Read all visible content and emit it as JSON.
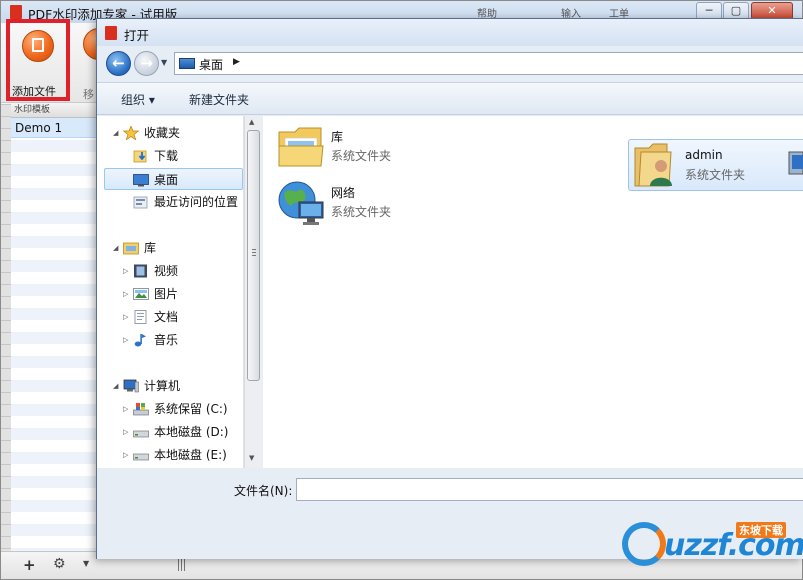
{
  "app": {
    "title": "PDF水印添加专家 - 试用版",
    "menu": [
      "帮助",
      "输入",
      "工单"
    ],
    "window_controls": {
      "minimize": "─",
      "maximize": "▢",
      "close": "✕"
    },
    "toolbar": {
      "add_file_label": "添加文件",
      "move_label": "移"
    },
    "template_panel": {
      "header": "水印模板",
      "items": [
        "Demo 1"
      ]
    },
    "statusbar": {
      "add": "+",
      "settings": "⚙",
      "dropdown": "▼"
    }
  },
  "dialog": {
    "title": "打开",
    "address": {
      "location": "桌面",
      "chevron": "▶"
    },
    "nav_buttons": {
      "back": "←",
      "forward": "→",
      "history": "▼"
    },
    "commands": {
      "organize": "组织 ▾",
      "new_folder": "新建文件夹"
    },
    "nav_tree": {
      "favorites": {
        "label": "收藏夹",
        "items": [
          "下载",
          "桌面",
          "最近访问的位置"
        ]
      },
      "libraries": {
        "label": "库",
        "items": [
          "视频",
          "图片",
          "文档",
          "音乐"
        ]
      },
      "computer": {
        "label": "计算机",
        "items": [
          "系统保留 (C:)",
          "本地磁盘 (D:)",
          "本地磁盘 (E:)"
        ]
      }
    },
    "content_items": [
      {
        "name": "库",
        "type": "系统文件夹"
      },
      {
        "name": "admin",
        "type": "系统文件夹"
      },
      {
        "name": "网络",
        "type": "系统文件夹"
      }
    ],
    "filename": {
      "label": "文件名(N):",
      "value": ""
    }
  },
  "watermark": {
    "brand": "uzzf.com",
    "badge": "东坡下载"
  },
  "colors": {
    "accent_red": "#e0202a",
    "selection_blue": "#d8e9fb",
    "dialog_bg": "#e7edf5"
  }
}
